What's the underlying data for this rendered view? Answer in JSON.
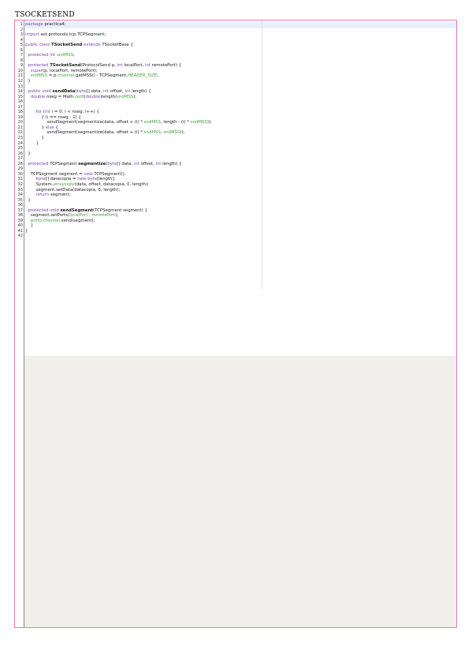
{
  "document": {
    "title": "TSOCKETSEND"
  },
  "code_lines": [
    [
      {
        "t": "package",
        "c": "kw"
      },
      {
        "t": " practica4;"
      }
    ],
    [],
    [
      {
        "t": "import",
        "c": "kw"
      },
      {
        "t": " ast.protocols.tcp.TCPSegment;"
      }
    ],
    [],
    [
      {
        "t": "public class",
        "c": "kw"
      },
      {
        "t": " "
      },
      {
        "t": "TSocketSend",
        "c": "b"
      },
      {
        "t": " "
      },
      {
        "t": "extends",
        "c": "kw"
      },
      {
        "t": " TSocketBase {"
      }
    ],
    [],
    [
      {
        "t": "  "
      },
      {
        "t": "protected int",
        "c": "kw"
      },
      {
        "t": " "
      },
      {
        "t": "sndMSS",
        "c": "fld"
      },
      {
        "t": ";"
      }
    ],
    [],
    [
      {
        "t": "  "
      },
      {
        "t": "protected",
        "c": "kw"
      },
      {
        "t": " "
      },
      {
        "t": "TSocketSend",
        "c": "b"
      },
      {
        "t": "(ProtocolSend p, "
      },
      {
        "t": "int",
        "c": "kw"
      },
      {
        "t": " localPort, "
      },
      {
        "t": "int",
        "c": "kw"
      },
      {
        "t": " remotePort) {"
      }
    ],
    [
      {
        "t": "    "
      },
      {
        "t": "super",
        "c": "kw"
      },
      {
        "t": "(p, localPort, remotePort);"
      }
    ],
    [
      {
        "t": "    "
      },
      {
        "t": "sndMSS",
        "c": "fld"
      },
      {
        "t": " = p."
      },
      {
        "t": "channel",
        "c": "fld"
      },
      {
        "t": ".getMSS() - TCPSegment."
      },
      {
        "t": "HEADER_SIZE",
        "c": "cst"
      },
      {
        "t": ";"
      }
    ],
    [
      {
        "t": "  }"
      }
    ],
    [],
    [
      {
        "t": "  "
      },
      {
        "t": "public void",
        "c": "kw"
      },
      {
        "t": " "
      },
      {
        "t": "sendData",
        "c": "b"
      },
      {
        "t": "("
      },
      {
        "t": "byte",
        "c": "kw"
      },
      {
        "t": "[] data, "
      },
      {
        "t": "int",
        "c": "kw"
      },
      {
        "t": " offset, "
      },
      {
        "t": "int",
        "c": "kw"
      },
      {
        "t": " length) {"
      }
    ],
    [
      {
        "t": "    "
      },
      {
        "t": "double",
        "c": "kw"
      },
      {
        "t": " nseg = Math."
      },
      {
        "t": "ceil",
        "c": "cst"
      },
      {
        "t": "(("
      },
      {
        "t": "double",
        "c": "kw"
      },
      {
        "t": ")length/"
      },
      {
        "t": "sndMSS",
        "c": "fld"
      },
      {
        "t": ");"
      }
    ],
    [],
    [],
    [
      {
        "t": "        "
      },
      {
        "t": "for",
        "c": "kw"
      },
      {
        "t": " ("
      },
      {
        "t": "int",
        "c": "kw"
      },
      {
        "t": " i = 0; i < nseg; i++) {"
      }
    ],
    [
      {
        "t": "            "
      },
      {
        "t": "if",
        "c": "kw"
      },
      {
        "t": " (i == nseg - 1) {"
      }
    ],
    [
      {
        "t": "                sendSegment(segmentize(data, offset + (i) * "
      },
      {
        "t": "sndMSS",
        "c": "fld"
      },
      {
        "t": ", length - (i) * "
      },
      {
        "t": "sndMSS",
        "c": "fld"
      },
      {
        "t": "));"
      }
    ],
    [
      {
        "t": "            } "
      },
      {
        "t": "else",
        "c": "kw"
      },
      {
        "t": " {"
      }
    ],
    [
      {
        "t": "                sendSegment(segmentize(data, offset + (i) * "
      },
      {
        "t": "sndMSS",
        "c": "fld"
      },
      {
        "t": ", "
      },
      {
        "t": "sndMSS",
        "c": "fld"
      },
      {
        "t": "));"
      }
    ],
    [
      {
        "t": "            }"
      }
    ],
    [
      {
        "t": "        }"
      }
    ],
    [],
    [
      {
        "t": "  }"
      }
    ],
    [],
    [
      {
        "t": "  "
      },
      {
        "t": "protected",
        "c": "kw"
      },
      {
        "t": " TCPSegment "
      },
      {
        "t": "segmentize",
        "c": "b"
      },
      {
        "t": "("
      },
      {
        "t": "byte",
        "c": "kw"
      },
      {
        "t": "[] data, "
      },
      {
        "t": "int",
        "c": "kw"
      },
      {
        "t": " offset, "
      },
      {
        "t": "int",
        "c": "kw"
      },
      {
        "t": " length) {"
      }
    ],
    [],
    [
      {
        "t": "    TCPSegment segment = "
      },
      {
        "t": "new",
        "c": "kw"
      },
      {
        "t": " TCPSegment();"
      }
    ],
    [
      {
        "t": "        "
      },
      {
        "t": "byte",
        "c": "kw"
      },
      {
        "t": "[] datacopia = "
      },
      {
        "t": "new",
        "c": "kw"
      },
      {
        "t": " "
      },
      {
        "t": "byte",
        "c": "kw"
      },
      {
        "t": "[length];"
      }
    ],
    [
      {
        "t": "        System."
      },
      {
        "t": "arraycopy",
        "c": "cst"
      },
      {
        "t": "(data, offset, datacopia, 0, length);"
      }
    ],
    [
      {
        "t": "        segment.setData(datacopia, 0, length);"
      }
    ],
    [
      {
        "t": "        "
      },
      {
        "t": "return",
        "c": "kw"
      },
      {
        "t": " segment;"
      }
    ],
    [
      {
        "t": "  }"
      }
    ],
    [],
    [
      {
        "t": "  "
      },
      {
        "t": "protected void",
        "c": "kw"
      },
      {
        "t": " "
      },
      {
        "t": "sendSegment",
        "c": "b"
      },
      {
        "t": "(TCPSegment segment) {"
      }
    ],
    [
      {
        "t": "    segment.setPorts("
      },
      {
        "t": "localPort",
        "c": "fld"
      },
      {
        "t": " , "
      },
      {
        "t": "remotePort",
        "c": "fld"
      },
      {
        "t": ");"
      }
    ],
    [
      {
        "t": "    "
      },
      {
        "t": "proto",
        "c": "fld"
      },
      {
        "t": "."
      },
      {
        "t": "channel",
        "c": "fld"
      },
      {
        "t": ".send(segment);"
      }
    ],
    [
      {
        "t": "    }"
      }
    ],
    [
      {
        "t": "}"
      }
    ],
    []
  ]
}
